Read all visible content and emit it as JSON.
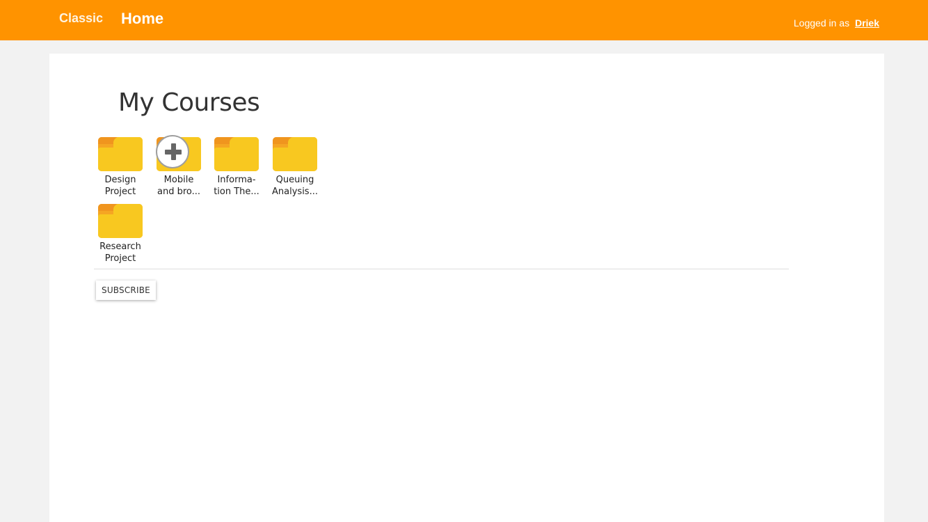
{
  "header": {
    "classic_label": "Classic",
    "home_label": "Home",
    "logged_in_prefix": "Logged in as",
    "username": "Driek",
    "background_color": "#ff9300"
  },
  "main": {
    "title": "My Courses",
    "courses": [
      {
        "line1": "Design",
        "line2": "Project",
        "icon": "folder-icon"
      },
      {
        "line1": "Mobile",
        "line2": "and bro...",
        "icon": "folder-icon"
      },
      {
        "line1": "Informa-",
        "line2": "tion The...",
        "icon": "folder-icon"
      },
      {
        "line1": "Queuing",
        "line2": "Analysis...",
        "icon": "folder-icon"
      },
      {
        "line1": "Research",
        "line2": "Project",
        "icon": "folder-icon"
      }
    ],
    "add_course_icon": "plus-circle-icon",
    "subscribe_label": "SUBSCRIBE"
  }
}
